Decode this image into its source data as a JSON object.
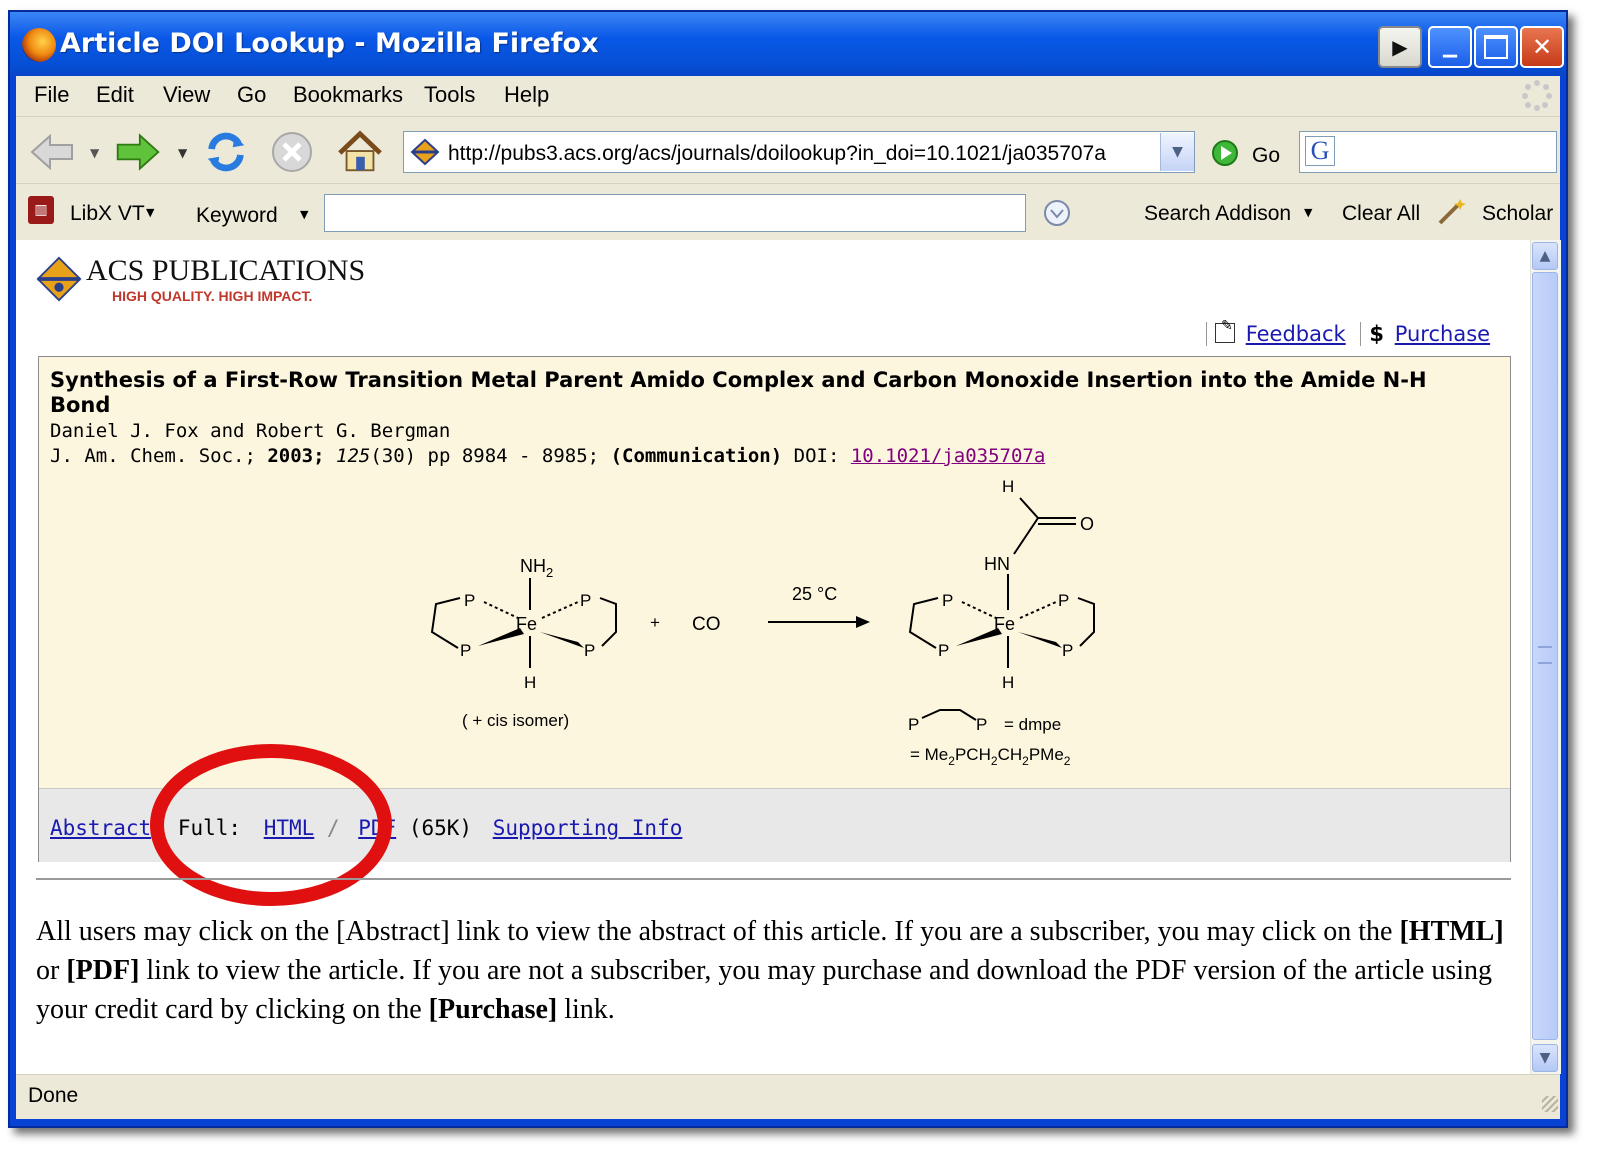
{
  "window": {
    "title": "Article DOI Lookup - Mozilla Firefox"
  },
  "menu": {
    "items": [
      "File",
      "Edit",
      "View",
      "Go",
      "Bookmarks",
      "Tools",
      "Help"
    ]
  },
  "navbar": {
    "url": "http://pubs3.acs.org/acs/journals/doilookup?in_doi=10.1021/ja035707a",
    "go_label": "Go",
    "search_value": ""
  },
  "libx": {
    "name": "LibX VT",
    "keyword_label": "Keyword",
    "keyword_value": "",
    "search_label": "Search Addison",
    "clear_label": "Clear All",
    "scholar_label": "Scholar"
  },
  "site": {
    "name": "ACS PUBLICATIONS",
    "tagline": "HIGH QUALITY. HIGH IMPACT.",
    "feedback": "Feedback",
    "purchase_symbol": "$",
    "purchase": "Purchase"
  },
  "article": {
    "title": "Synthesis of a First-Row Transition Metal Parent Amido Complex and Carbon Monoxide Insertion into the Amide N-H Bond",
    "authors": "Daniel J. Fox and Robert G. Bergman",
    "journal": "J. Am. Chem. Soc.;",
    "year": "2003;",
    "volume": "125",
    "issue_pages": "(30) pp 8984 - 8985;",
    "type": "(Communication)",
    "doi_label": "DOI:",
    "doi": "10.1021/ja035707a"
  },
  "scheme": {
    "nh2": "NH",
    "nh2_sub": "2",
    "fe": "Fe",
    "p": "P",
    "h": "H",
    "plus": "+",
    "co": "CO",
    "conditions": "25 °C",
    "cis_note": "( + cis isomer)",
    "hn": "HN",
    "o": "O",
    "dmpe": "= dmpe",
    "formula_prefix": "= Me",
    "formula_parts": [
      "2",
      "PCH",
      "2",
      "CH",
      "2",
      "PMe",
      "2"
    ]
  },
  "links": {
    "abstract": "Abstract",
    "full_label": "Full:",
    "html": "HTML",
    "slash": "/",
    "pdf": "PDF",
    "size": "(65K)",
    "supporting": "Supporting Info"
  },
  "info": {
    "part1": "All users may click on the [Abstract] link to view the abstract of this article. If you are a subscriber, you may click on the ",
    "html_bold": "[HTML]",
    "or": " or ",
    "pdf_bold": "[PDF]",
    "part2": " link to view the article. If you are not a subscriber, you may purchase and download the PDF version of the article using your credit card by clicking on the ",
    "purchase_bold": "[Purchase]",
    "part3": " link."
  },
  "status": {
    "text": "Done"
  },
  "colors": {
    "titlebar": "#0a58e8",
    "link": "#1a1ab0",
    "visited_link": "#800080",
    "annotation_circle": "#e01010",
    "article_bg": "#fdf6df"
  }
}
